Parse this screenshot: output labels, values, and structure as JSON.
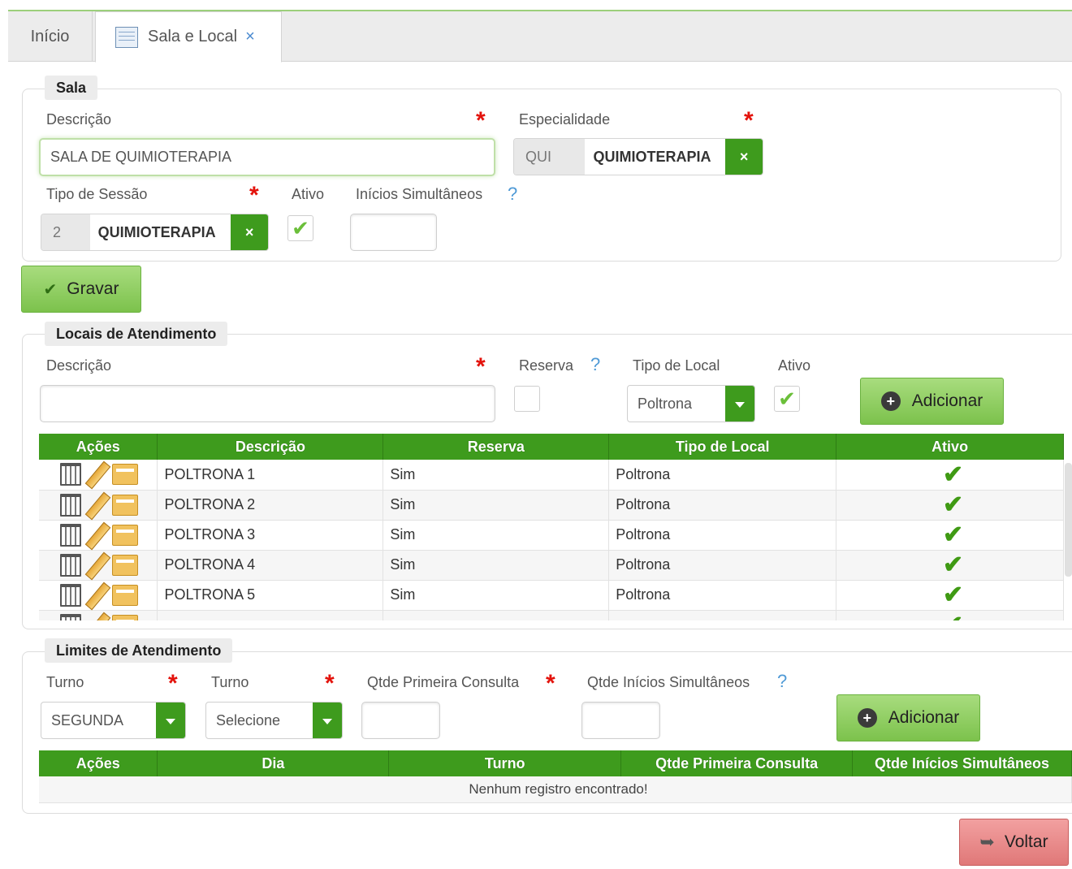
{
  "tabs": {
    "inicio": "Início",
    "active": "Sala e Local",
    "close": "×"
  },
  "sala": {
    "legend": "Sala",
    "descricao_label": "Descrição",
    "descricao_value": "SALA DE QUIMIOTERAPIA",
    "especialidade_label": "Especialidade",
    "especialidade_code": "QUI",
    "especialidade_name": "QUIMIOTERAPIA",
    "tipo_sessao_label": "Tipo de Sessão",
    "tipo_sessao_code": "2",
    "tipo_sessao_name": "QUIMIOTERAPIA",
    "ativo_label": "Ativo",
    "ativo_checked": true,
    "inicios_label": "Inícios Simultâneos",
    "inicios_value": "",
    "help": "?",
    "required": "*",
    "clear": "×"
  },
  "gravar": {
    "label": "Gravar",
    "icon": "check-icon"
  },
  "locais": {
    "legend": "Locais de Atendimento",
    "descricao_label": "Descrição",
    "reserva_label": "Reserva",
    "tipo_local_label": "Tipo de Local",
    "tipo_local_value": "Poltrona",
    "ativo_label": "Ativo",
    "add_label": "Adicionar",
    "help": "?",
    "columns": [
      "Ações",
      "Descrição",
      "Reserva",
      "Tipo de Local",
      "Ativo"
    ],
    "rows": [
      {
        "descricao": "POLTRONA 1",
        "reserva": "Sim",
        "tipo": "Poltrona",
        "ativo": "✔"
      },
      {
        "descricao": "POLTRONA 2",
        "reserva": "Sim",
        "tipo": "Poltrona",
        "ativo": "✔"
      },
      {
        "descricao": "POLTRONA 3",
        "reserva": "Sim",
        "tipo": "Poltrona",
        "ativo": "✔"
      },
      {
        "descricao": "POLTRONA 4",
        "reserva": "Sim",
        "tipo": "Poltrona",
        "ativo": "✔"
      },
      {
        "descricao": "POLTRONA 5",
        "reserva": "Sim",
        "tipo": "Poltrona",
        "ativo": "✔"
      }
    ]
  },
  "limites": {
    "legend": "Limites de Atendimento",
    "turno1_label": "Turno",
    "turno1_value": "SEGUNDA",
    "turno2_label": "Turno",
    "turno2_value": "Selecione",
    "qtde_primeira_label": "Qtde Primeira Consulta",
    "qtde_inicios_label": "Qtde Inícios Simultâneos",
    "add_label": "Adicionar",
    "help": "?",
    "columns": [
      "Ações",
      "Dia",
      "Turno",
      "Qtde Primeira Consulta",
      "Qtde Inícios Simultâneos"
    ],
    "empty_message": "Nenhum registro encontrado!"
  },
  "voltar": {
    "label": "Voltar",
    "icon": "back-arrow-icon"
  },
  "colors": {
    "green": "#3e9b1d",
    "button_green": "#8ccf5b",
    "button_red": "#e98c8c",
    "required": "#e3120b",
    "help": "#4f9ad6"
  }
}
